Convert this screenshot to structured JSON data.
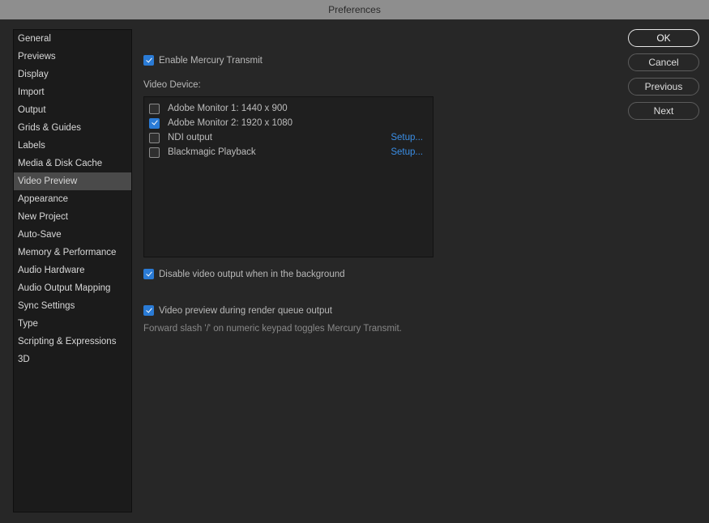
{
  "title": "Preferences",
  "sidebar": {
    "items": [
      {
        "label": "General"
      },
      {
        "label": "Previews"
      },
      {
        "label": "Display"
      },
      {
        "label": "Import"
      },
      {
        "label": "Output"
      },
      {
        "label": "Grids & Guides"
      },
      {
        "label": "Labels"
      },
      {
        "label": "Media & Disk Cache"
      },
      {
        "label": "Video Preview"
      },
      {
        "label": "Appearance"
      },
      {
        "label": "New Project"
      },
      {
        "label": "Auto-Save"
      },
      {
        "label": "Memory & Performance"
      },
      {
        "label": "Audio Hardware"
      },
      {
        "label": "Audio Output Mapping"
      },
      {
        "label": "Sync Settings"
      },
      {
        "label": "Type"
      },
      {
        "label": "Scripting & Expressions"
      },
      {
        "label": "3D"
      }
    ],
    "selected_index": 8
  },
  "content": {
    "enable_transmit_label": "Enable Mercury Transmit",
    "video_device_heading": "Video Device:",
    "devices": [
      {
        "label": "Adobe Monitor 1: 1440 x 900",
        "checked": false,
        "setup": ""
      },
      {
        "label": "Adobe Monitor 2: 1920 x 1080",
        "checked": true,
        "setup": ""
      },
      {
        "label": "NDI output",
        "checked": false,
        "setup": "Setup..."
      },
      {
        "label": "Blackmagic Playback",
        "checked": false,
        "setup": "Setup..."
      }
    ],
    "disable_bg_label": "Disable video output when in the background",
    "preview_rq_label": "Video preview during render queue output",
    "hint": "Forward slash '/' on numeric keypad toggles Mercury Transmit."
  },
  "buttons": {
    "ok": "OK",
    "cancel": "Cancel",
    "previous": "Previous",
    "next": "Next"
  }
}
